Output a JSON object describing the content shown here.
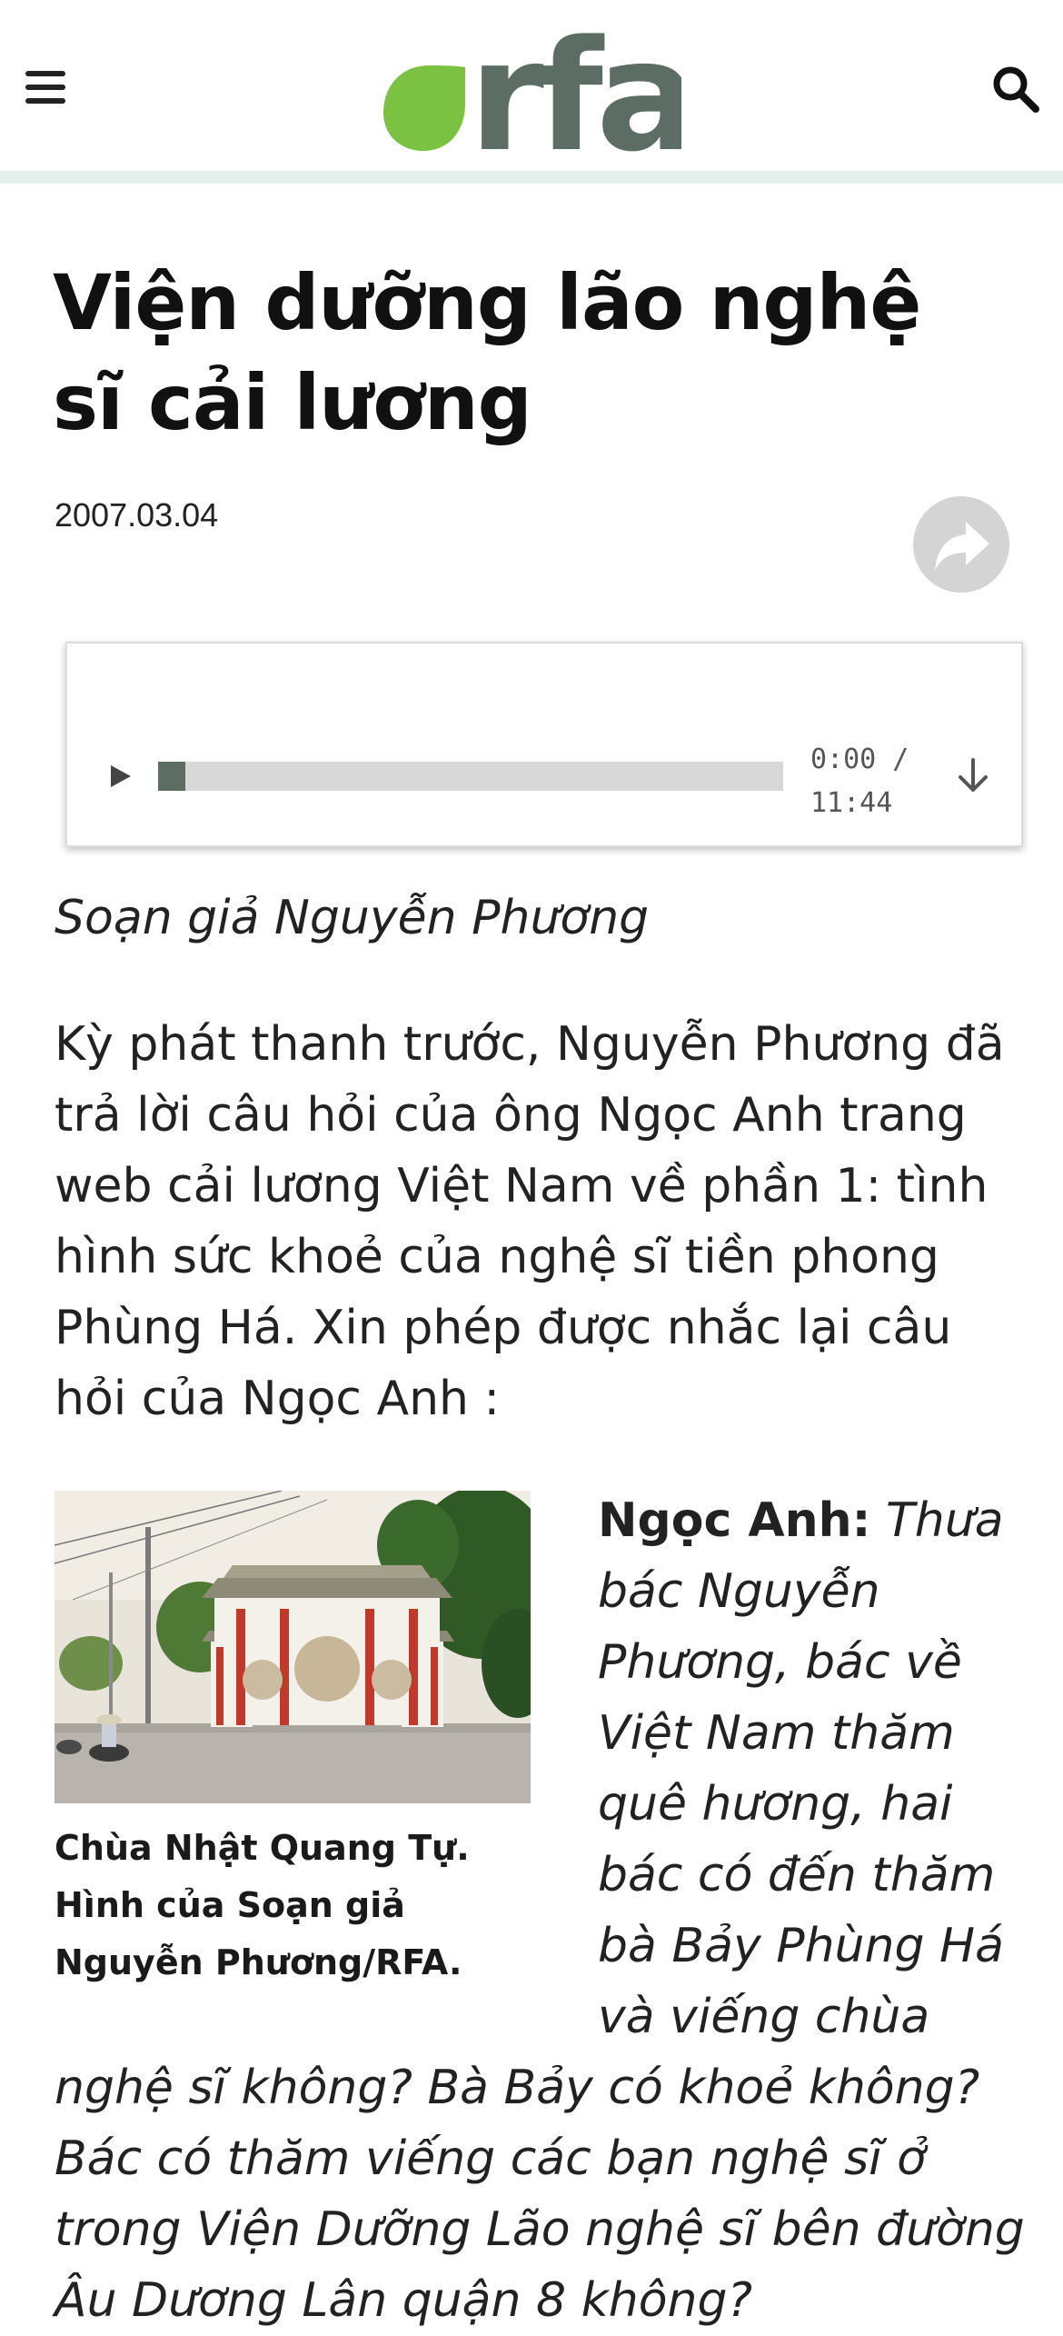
{
  "header": {
    "logo_text": "rfa",
    "menu_icon": "hamburger-menu-icon",
    "search_icon": "search-icon",
    "brand_green": "#7cc242",
    "brand_gray": "#5c6e63"
  },
  "article": {
    "title": "Viện dưỡng lão nghệ sĩ cải lương",
    "date": "2007.03.04",
    "share_icon": "share-arrow-icon",
    "byline": "Soạn giả Nguyễn Phương",
    "paragraph_1": "Kỳ phát thanh trước, Nguyễn Phương đã trả lời câu hỏi của ông Ngọc Anh trang web cải lương Việt Nam về phần 1: tình hình sức khoẻ của nghệ sĩ tiền phong Phùng Há. Xin phép được nhắc lại câu hỏi của Ngọc Anh :",
    "image_caption": "Chùa Nhật Quang Tự. Hình của Soạn giả Nguyễn Phương/RFA.",
    "qa_label": "Ngọc Anh:",
    "qa_question_part1": "Thưa bác Nguyễn Phương, bác về Việt Nam thăm quê hương, hai bác có đến thăm bà Bảy Phùng Há và viếng chùa",
    "qa_question_part2": "nghệ sĩ không? Bà Bảy có khoẻ không? Bác có thăm viếng các bạn nghệ sĩ ở trong Viện Dưỡng Lão nghệ sĩ bên đường Âu Dương Lân quận 8 không?"
  },
  "player": {
    "current_time": "0:00 /",
    "duration": "11:44",
    "progress": 0.0,
    "play_icon": "play-icon",
    "download_icon": "download-arrow-icon"
  }
}
